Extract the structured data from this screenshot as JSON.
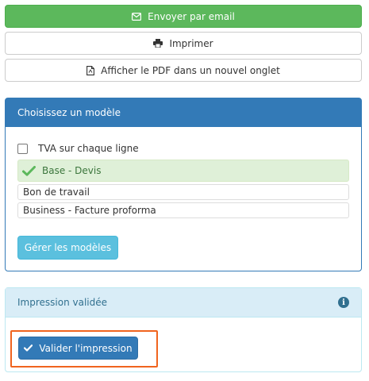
{
  "actions": {
    "email_label": "Envoyer par email",
    "print_label": "Imprimer",
    "pdf_label": "Afficher le PDF dans un nouvel onglet"
  },
  "model_panel": {
    "title": "Choisissez un modèle",
    "vat_checkbox": {
      "label": "TVA sur chaque ligne",
      "checked": false
    },
    "models": [
      {
        "label": "Base - Devis",
        "selected": true
      },
      {
        "label": "Bon de travail",
        "selected": false
      },
      {
        "label": "Business - Facture proforma",
        "selected": false
      }
    ],
    "manage_label": "Gérer les modèles"
  },
  "validate_panel": {
    "title": "Impression validée",
    "info_icon": "info-circle-icon",
    "validate_label": "Valider l'impression"
  },
  "colors": {
    "success": "#5cb85c",
    "primary": "#337ab7",
    "info": "#5bc0de",
    "highlight": "#f0641e"
  }
}
